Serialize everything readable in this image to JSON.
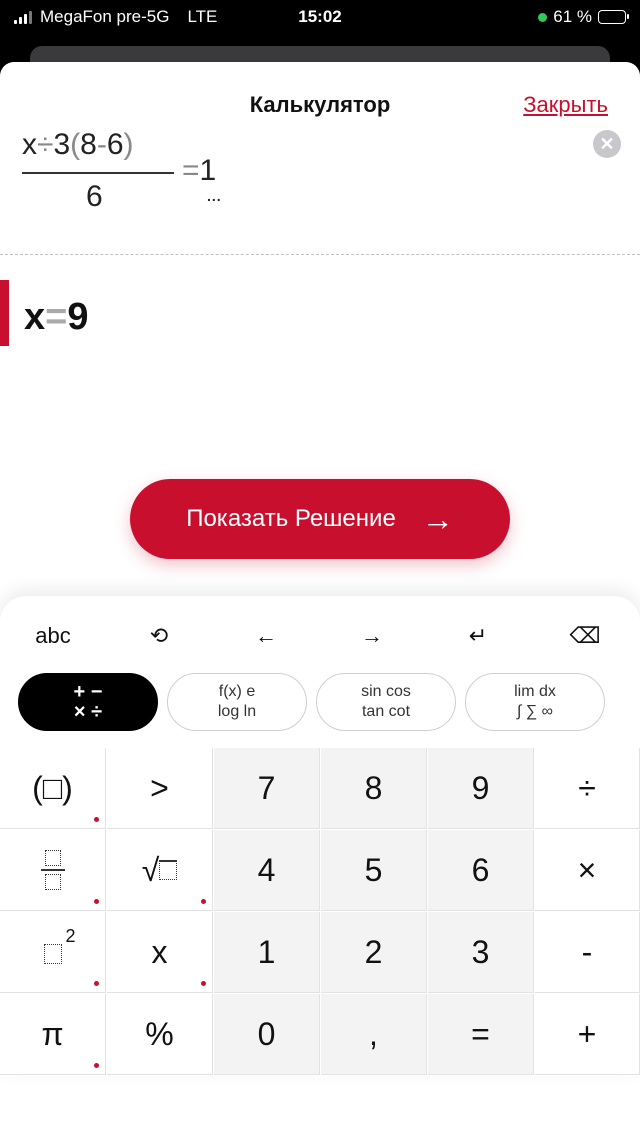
{
  "status": {
    "carrier": "MegaFon pre-5G",
    "network": "LTE",
    "time": "15:02",
    "battery": "61 %",
    "battery_level": 0.61
  },
  "header": {
    "title": "Калькулятор",
    "close_label": "Закрыть"
  },
  "expression": {
    "numerator": [
      "x",
      "÷",
      "3",
      "(",
      "8",
      "-",
      "6",
      ")"
    ],
    "denominator": "6",
    "equals": "=",
    "rhs": "1",
    "dots": "..."
  },
  "result": {
    "variable": "x",
    "equals": "=",
    "value": "9"
  },
  "solution_button": {
    "label": "Показать Решение",
    "arrow": "→"
  },
  "toolbar": {
    "abc": "abc",
    "history": "⟲",
    "left": "←",
    "right": "→",
    "enter": "↵",
    "backspace": "⌫"
  },
  "modes": [
    {
      "line1": "+ −",
      "line2": "× ÷"
    },
    {
      "line1": "f(x)  e",
      "line2": "log  ln"
    },
    {
      "line1": "sin cos",
      "line2": "tan cot"
    },
    {
      "line1": "lim  dx",
      "line2": "∫ ∑ ∞"
    }
  ],
  "keys": {
    "paren": "(□)",
    "gt": ">",
    "sqrt": "√",
    "square_exp": "2",
    "x": "x",
    "pi": "π",
    "percent": "%",
    "n7": "7",
    "n8": "8",
    "n9": "9",
    "n4": "4",
    "n5": "5",
    "n6": "6",
    "n1": "1",
    "n2": "2",
    "n3": "3",
    "n0": "0",
    "comma": ",",
    "equals": "=",
    "div": "÷",
    "mul": "×",
    "minus": "-",
    "plus": "+"
  },
  "colors": {
    "accent": "#c8102e"
  }
}
